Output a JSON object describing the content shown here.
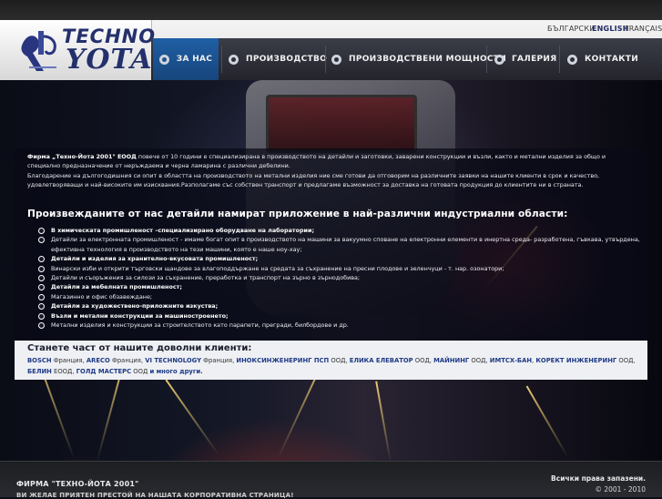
{
  "languages": [
    {
      "label": "БЪЛГАРСКИ",
      "active": false
    },
    {
      "label": "ENGLISH",
      "active": true
    },
    {
      "label": "FRANÇAIS",
      "active": false
    }
  ],
  "logo": {
    "line1": "TECHNO",
    "line2": "YOTA"
  },
  "nav": [
    {
      "label": "ЗА НАС",
      "active": true
    },
    {
      "label": "ПРОИЗВОДСТВО",
      "active": false
    },
    {
      "label": "ПРОИЗВОДСТВЕНИ МОЩНОСТИ",
      "active": false
    },
    {
      "label": "ГАЛЕРИЯ",
      "active": false
    },
    {
      "label": "КОНТАКТИ",
      "active": false
    }
  ],
  "intro": {
    "company": "Фирма „Техно-Йота 2001\" ЕООД",
    "text1": " повече от 10 години е специализирана в производството на детайли и заготовки, заварени конструкции и възли, както и метални изделия за общо и специално предназначение от неръждаема и черна ламарина с различни дебелини.",
    "text2": "Благодарение на дългогодишния си опит в областта на производството на метални изделия ние сме готови да отговорим на различните заявки на нашите клиенти в срок и качество, удовлетворяващи и най-високите им изисквания.Разполагаме със собствен транспорт и предлагаме възможност за доставка на готовата продукция до клиентите ни в страната."
  },
  "heading": "Произвежданите от нас детайли намират приложение в най-различни индустриални области:",
  "bullets": [
    {
      "text": "В химическата промишленост –специализирано оборудване на лаборатории;",
      "bold": true
    },
    {
      "text": "Детайли за електронната промишленост - имаме богат опит в производството на машини за вакуумно споване на електронни елементи в инертна среда- разработена, гъвкава, утвърдена, ефективна технология в производството на тези машини, която е наше ноу-хау;",
      "bold": false
    },
    {
      "text": "Детайли и изделия за хранително-вкусовата промишленост;",
      "bold": true
    },
    {
      "text": "Винарски изби и открити търговски щандове за влагоподдържане на средата за съхранение на пресни плодове и зеленчуци - т. нар. озонатори;",
      "bold": false
    },
    {
      "text": "Детайли и съоръжения за силози за съхранение, преработка и транспорт на зърно в зърнодобива;",
      "bold": false
    },
    {
      "text": "Детайли за мебелната промишленост;",
      "bold": true
    },
    {
      "text": "Магазинно и офис обзавеждане;",
      "bold": false
    },
    {
      "text": "Детайли за художествено-приложните изкуства;",
      "bold": true
    },
    {
      "text": "Възли и метални конструкции за машиностроенето;",
      "bold": true
    },
    {
      "text": "Метални изделия и конструкции за строителството като парапети, прегради, билбордове и др.",
      "bold": false
    }
  ],
  "clients": {
    "title": "Станете част от нашите доволни клиенти:",
    "items": [
      {
        "name": "BOSCH",
        "suffix": " Франция, "
      },
      {
        "name": "ARECO",
        "suffix": " Франция, "
      },
      {
        "name": "VI TECHNOLOGY",
        "suffix": " Франция, "
      },
      {
        "name": "ИНОКСИНЖЕНЕРИНГ ПСП",
        "suffix": " ООД, "
      },
      {
        "name": "ЕЛИКА ЕЛЕВАТОР",
        "suffix": " ООД, "
      },
      {
        "name": "МАЙНИНГ",
        "suffix": " ООД, "
      },
      {
        "name": "ИМТСХ-БАН",
        "suffix": ", "
      },
      {
        "name": "КОРЕКТ ИНЖЕНЕРИНГ",
        "suffix": " ООД, "
      },
      {
        "name": "БЕЛИН",
        "suffix": " ЕООД, "
      },
      {
        "name": "ГОЛД МАСТЕРС",
        "suffix": " ООД "
      },
      {
        "name": "и много други.",
        "suffix": ""
      }
    ]
  },
  "footer": {
    "company": "ФИРМА \"ТЕХНО-ЙОТА 2001\"",
    "slogan": "ВИ ЖЕЛАЕ ПРИЯТЕН ПРЕСТОЙ НА НАШАТА КОРПОРАТИВНА СТРАНИЦА!",
    "rights": "Всички права запазени.",
    "year": "© 2001 - 2010"
  }
}
